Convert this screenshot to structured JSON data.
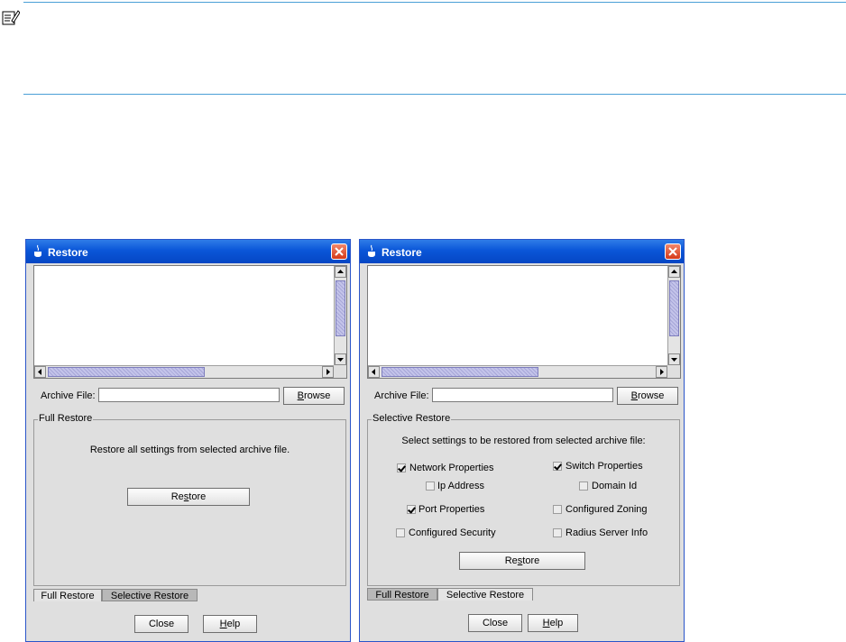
{
  "windows": [
    {
      "title": "Restore",
      "archive_label": "Archive File:",
      "archive_value": "",
      "browse_label": "Browse",
      "panel_title": "Full Restore",
      "panel_description": "Restore all settings from selected archive file.",
      "restore_label": "Restore",
      "tabs": [
        "Full Restore",
        "Selective Restore"
      ],
      "active_tab": "Full Restore",
      "close_label": "Close",
      "help_label": "Help"
    },
    {
      "title": "Restore",
      "archive_label": "Archive File:",
      "archive_value": "",
      "browse_label": "Browse",
      "panel_title": "Selective Restore",
      "panel_description": "Select settings to be restored from selected archive file:",
      "options": [
        {
          "label": "Network Properties",
          "checked": true
        },
        {
          "label": "Switch Properties",
          "checked": true
        },
        {
          "label": "Ip Address",
          "checked": false
        },
        {
          "label": "Domain Id",
          "checked": false
        },
        {
          "label": "Port Properties",
          "checked": true
        },
        {
          "label": "Configured Zoning",
          "checked": false
        },
        {
          "label": "Configured Security",
          "checked": false
        },
        {
          "label": "Radius Server Info",
          "checked": false
        }
      ],
      "restore_label": "Restore",
      "tabs": [
        "Full Restore",
        "Selective Restore"
      ],
      "active_tab": "Selective Restore",
      "close_label": "Close",
      "help_label": "Help"
    }
  ]
}
